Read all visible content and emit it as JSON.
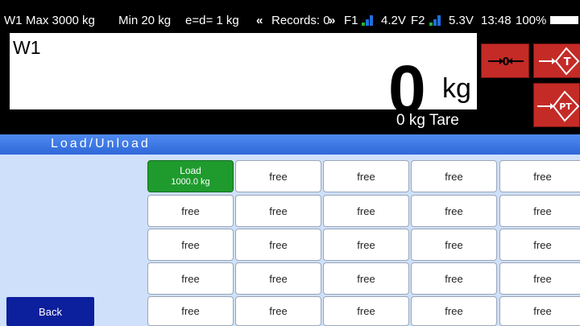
{
  "status": {
    "scale_name": "W1",
    "max": "Max 3000 kg",
    "min": "Min 20 kg",
    "division": "e=d= 1 kg",
    "records_prev_icon": "«",
    "records": "Records: 0",
    "records_next_icon": "»",
    "f1_label": "F1",
    "f1_voltage": "4.2V",
    "f2_label": "F2",
    "f2_voltage": "5.3V",
    "time": "13:48",
    "battery": "100%"
  },
  "weight": {
    "name": "W1",
    "value": "0",
    "unit": "kg",
    "tare": "0 kg Tare"
  },
  "buttons": {
    "zero_icon": "zero-icon",
    "tare_icon": "tare-icon",
    "preset_tare_icon": "preset-tare-icon",
    "back": "Back"
  },
  "colors": {
    "func_button": "#c42b26",
    "title_bar": "#2f68d8",
    "loaded_slot": "#1f9b2e",
    "back_button": "#0c1f9c",
    "signal_blue": "#1f6fe0",
    "signal_green": "#1fb33a"
  },
  "screen": {
    "title": "Load/Unload"
  },
  "slots": [
    {
      "line1": "Load",
      "line2": "1000.0 kg",
      "state": "loaded"
    },
    {
      "line1": "free",
      "state": "free"
    },
    {
      "line1": "free",
      "state": "free"
    },
    {
      "line1": "free",
      "state": "free"
    },
    {
      "line1": "free",
      "state": "free"
    },
    {
      "line1": "free",
      "state": "free"
    },
    {
      "line1": "free",
      "state": "free"
    },
    {
      "line1": "free",
      "state": "free"
    },
    {
      "line1": "free",
      "state": "free"
    },
    {
      "line1": "free",
      "state": "free"
    },
    {
      "line1": "free",
      "state": "free"
    },
    {
      "line1": "free",
      "state": "free"
    },
    {
      "line1": "free",
      "state": "free"
    },
    {
      "line1": "free",
      "state": "free"
    },
    {
      "line1": "free",
      "state": "free"
    },
    {
      "line1": "free",
      "state": "free"
    },
    {
      "line1": "free",
      "state": "free"
    },
    {
      "line1": "free",
      "state": "free"
    },
    {
      "line1": "free",
      "state": "free"
    },
    {
      "line1": "free",
      "state": "free"
    },
    {
      "line1": "free",
      "state": "free"
    },
    {
      "line1": "free",
      "state": "free"
    },
    {
      "line1": "free",
      "state": "free"
    },
    {
      "line1": "free",
      "state": "free"
    },
    {
      "line1": "free",
      "state": "free"
    }
  ]
}
